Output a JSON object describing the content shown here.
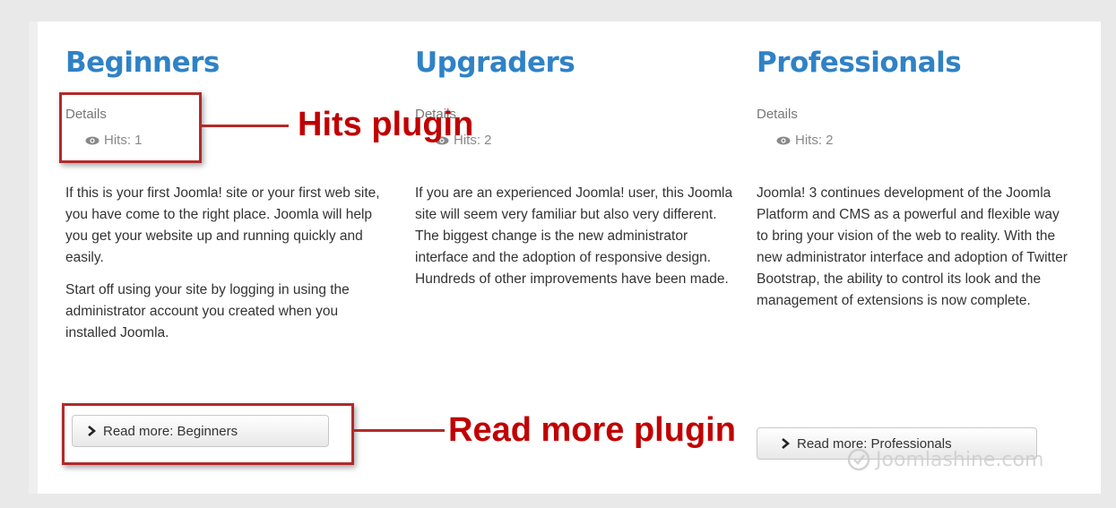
{
  "columns": [
    {
      "title": "Beginners",
      "details_label": "Details",
      "hits_text": "Hits: 1",
      "paragraphs": [
        "If this is your first Joomla! site or your first web site, you have come to the right place. Joomla will help you get your website up and running quickly and easily.",
        "Start off using your site by logging in using the administrator account you created when you installed Joomla."
      ],
      "read_more_label": "Read more: Beginners"
    },
    {
      "title": "Upgraders",
      "details_label": "Details",
      "hits_text": "Hits: 2",
      "paragraphs": [
        "If you are an experienced Joomla! user, this Joomla site will seem very familiar but also very different. The biggest change is the new administrator interface and the adoption of responsive design. Hundreds of other improvements have been made."
      ],
      "read_more_label": ""
    },
    {
      "title": "Professionals",
      "details_label": "Details",
      "hits_text": "Hits: 2",
      "paragraphs": [
        "Joomla! 3 continues development of the Joomla Platform and CMS as a powerful and flexible way to bring your vision of the web to reality. With the new administrator interface and adoption of Twitter Bootstrap, the ability to control its look and the management of extensions is now complete."
      ],
      "read_more_label": "Read more: Professionals"
    }
  ],
  "annotations": {
    "hits_plugin": "Hits plugin",
    "read_more_plugin": "Read more plugin"
  },
  "watermark": "Joomlashine.com",
  "colors": {
    "title": "#2f82c6",
    "annotation": "#c00000",
    "annotation_box": "#b12a2a"
  },
  "icons": {
    "hits": "eye-icon",
    "read_more": "chevron-right-icon",
    "watermark": "joomlashine-logo-icon"
  }
}
